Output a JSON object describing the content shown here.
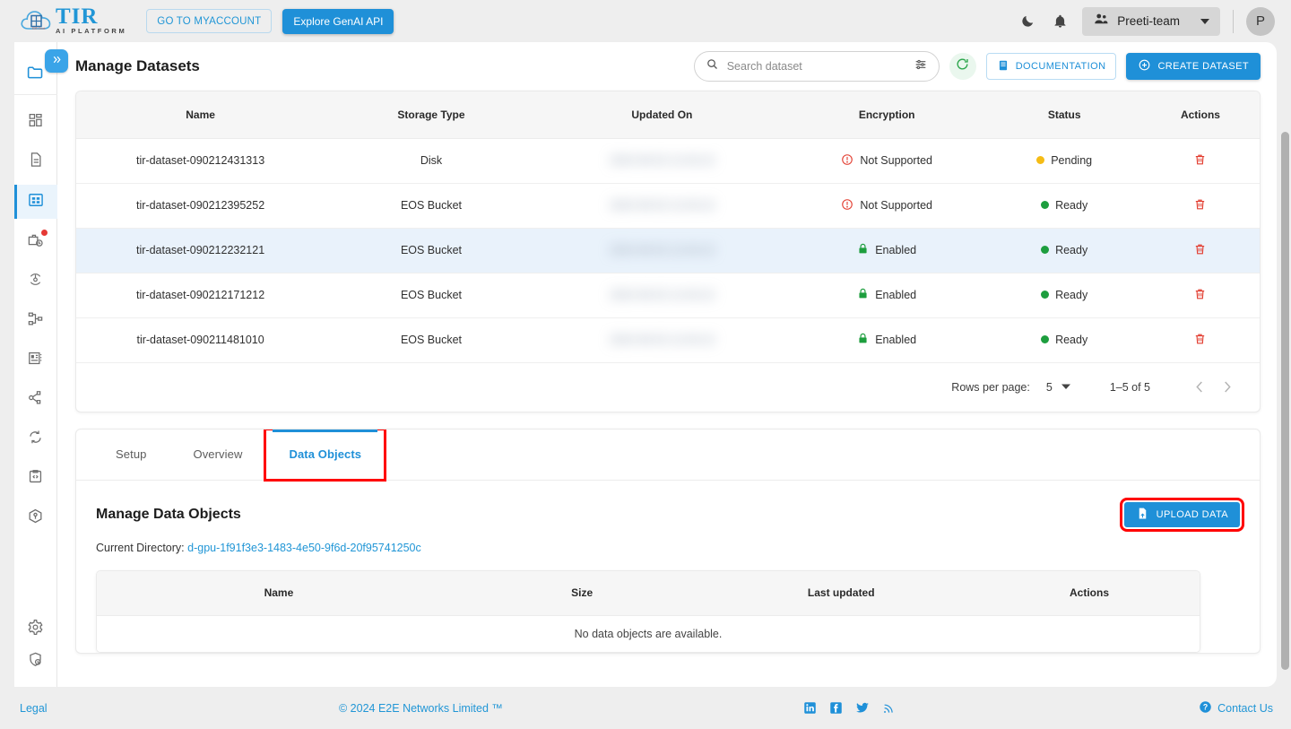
{
  "topbar": {
    "logo_title": "TIR",
    "logo_subtitle": "AI PLATFORM",
    "myaccount_label": "GO TO MYACCOUNT",
    "genai_label": "Explore GenAI API",
    "dark_mode_icon": "moon-icon",
    "notifications_icon": "bell-icon",
    "team_name": "Preeti-team",
    "team_icon": "people-icon",
    "avatar_initial": "P"
  },
  "sidebar": {
    "collapse_icon": "double-chevron-right-icon",
    "items": [
      {
        "name": "projects",
        "icon": "folder-icon"
      },
      {
        "name": "dashboard",
        "icon": "grid-dashboard-icon"
      },
      {
        "name": "notebooks",
        "icon": "document-icon"
      },
      {
        "name": "datasets",
        "icon": "dataset-grid-icon",
        "active": true
      },
      {
        "name": "jobs",
        "icon": "briefcase-clock-icon",
        "badge": true
      },
      {
        "name": "deployments",
        "icon": "rocket-target-icon"
      },
      {
        "name": "pipelines",
        "icon": "pipeline-nodes-icon"
      },
      {
        "name": "model-repos",
        "icon": "server-rack-icon"
      },
      {
        "name": "model-endpoints",
        "icon": "share-nodes-icon"
      },
      {
        "name": "sync",
        "icon": "sync-arrows-icon"
      },
      {
        "name": "api-tokens",
        "icon": "code-clipboard-icon"
      },
      {
        "name": "containers",
        "icon": "cube-box-icon"
      },
      {
        "name": "settings",
        "icon": "gear-icon"
      },
      {
        "name": "security",
        "icon": "shield-lock-icon"
      }
    ]
  },
  "page": {
    "title": "Manage Datasets"
  },
  "search": {
    "placeholder": "Search dataset",
    "value": "",
    "search_icon": "magnifier-icon",
    "filter_icon": "tune-sliders-icon"
  },
  "actions": {
    "refresh_icon": "refresh-circular-icon",
    "documentation_label": "DOCUMENTATION",
    "documentation_icon": "book-icon",
    "create_dataset_label": "CREATE DATASET",
    "create_icon": "plus-circle-icon"
  },
  "datasets_table": {
    "columns": [
      "Name",
      "Storage Type",
      "Updated On",
      "Encryption",
      "Status",
      "Actions"
    ],
    "rows": [
      {
        "name": "tir-dataset-090212431313",
        "storage_type": "Disk",
        "updated_on": "",
        "encryption": "Not Supported",
        "encryption_icon": "error-circle-icon",
        "encryption_color": "#e23b2e",
        "status": "Pending",
        "status_color": "#f5bc15",
        "action_icon": "trash-icon",
        "selected": false
      },
      {
        "name": "tir-dataset-090212395252",
        "storage_type": "EOS Bucket",
        "updated_on": "",
        "encryption": "Not Supported",
        "encryption_icon": "error-circle-icon",
        "encryption_color": "#e23b2e",
        "status": "Ready",
        "status_color": "#1d9e3e",
        "action_icon": "trash-icon",
        "selected": false
      },
      {
        "name": "tir-dataset-090212232121",
        "storage_type": "EOS Bucket",
        "updated_on": "",
        "encryption": "Enabled",
        "encryption_icon": "lock-icon",
        "encryption_color": "#1d9e3e",
        "status": "Ready",
        "status_color": "#1d9e3e",
        "action_icon": "trash-icon",
        "selected": true
      },
      {
        "name": "tir-dataset-090212171212",
        "storage_type": "EOS Bucket",
        "updated_on": "",
        "encryption": "Enabled",
        "encryption_icon": "lock-icon",
        "encryption_color": "#1d9e3e",
        "status": "Ready",
        "status_color": "#1d9e3e",
        "action_icon": "trash-icon",
        "selected": false
      },
      {
        "name": "tir-dataset-090211481010",
        "storage_type": "EOS Bucket",
        "updated_on": "",
        "encryption": "Enabled",
        "encryption_icon": "lock-icon",
        "encryption_color": "#1d9e3e",
        "status": "Ready",
        "status_color": "#1d9e3e",
        "action_icon": "trash-icon",
        "selected": false
      }
    ]
  },
  "pagination": {
    "rows_per_page_label": "Rows per page:",
    "rows_per_page_value": "5",
    "range_label": "1–5 of 5",
    "prev_icon": "chevron-left-icon",
    "next_icon": "chevron-right-icon"
  },
  "tabs": [
    {
      "label": "Setup",
      "active": false,
      "highlighted": false
    },
    {
      "label": "Overview",
      "active": false,
      "highlighted": false
    },
    {
      "label": "Data Objects",
      "active": true,
      "highlighted": true
    }
  ],
  "data_objects": {
    "title": "Manage Data Objects",
    "upload_label": "UPLOAD DATA",
    "upload_icon": "file-upload-icon",
    "current_directory_label": "Current Directory:",
    "current_directory_value": "d-gpu-1f91f3e3-1483-4e50-9f6d-20f95741250c",
    "columns": [
      "Name",
      "Size",
      "Last updated",
      "Actions"
    ],
    "empty_message": "No data objects are available."
  },
  "footer": {
    "legal": "Legal",
    "copyright": "© 2024 E2E Networks Limited ™",
    "social": [
      {
        "name": "linkedin-icon",
        "glyph": "in"
      },
      {
        "name": "facebook-icon",
        "glyph": "f"
      },
      {
        "name": "twitter-icon",
        "glyph": "t"
      },
      {
        "name": "rss-icon",
        "glyph": "r"
      }
    ],
    "contact_label": "Contact Us",
    "contact_icon": "help-circle-icon"
  },
  "colors": {
    "accent": "#1f90d8",
    "highlight_red": "#ff0000",
    "status_ready": "#1d9e3e",
    "status_pending": "#f5bc15",
    "danger": "#e23b2e"
  }
}
